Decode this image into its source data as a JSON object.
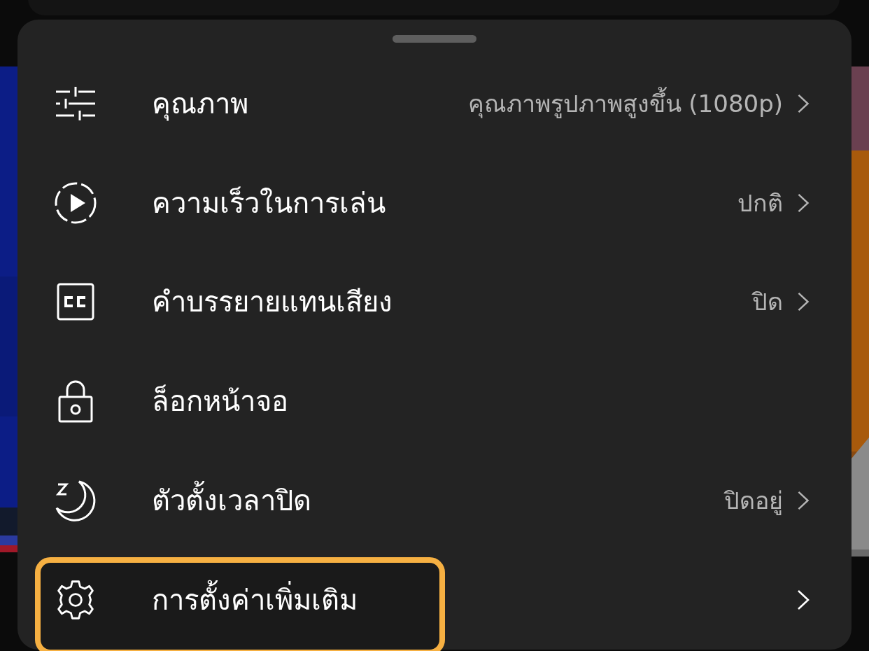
{
  "settings_sheet": {
    "items": [
      {
        "label": "คุณภาพ",
        "value": "คุณภาพรูปภาพสูงขึ้น (1080p)",
        "chevron": true,
        "highlighted": false
      },
      {
        "label": "ความเร็วในการเล่น",
        "value": "ปกติ",
        "chevron": true,
        "highlighted": false
      },
      {
        "label": "คำบรรยายแทนเสียง",
        "value": "ปิด",
        "chevron": true,
        "highlighted": false
      },
      {
        "label": "ล็อกหน้าจอ",
        "chevron": false,
        "highlighted": false
      },
      {
        "label": "ตัวตั้งเวลาปิด",
        "value": "ปิดอยู่",
        "chevron": true,
        "highlighted": false
      },
      {
        "label": "การตั้งค่าเพิ่มเติม",
        "chevron": true,
        "highlighted": true
      }
    ]
  }
}
